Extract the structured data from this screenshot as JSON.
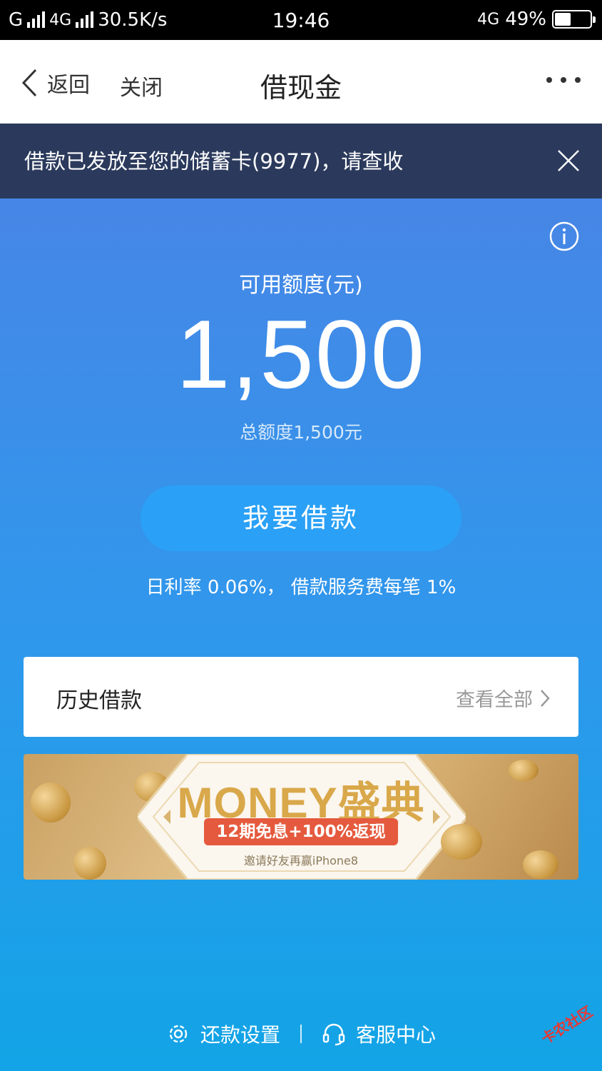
{
  "status_bar": {
    "carrier1": "G",
    "carrier2": "4G",
    "speed": "30.5K/s",
    "time": "19:46",
    "network": "4G",
    "battery": "49%"
  },
  "nav": {
    "back_label": "返回",
    "close_label": "关闭",
    "title": "借现金"
  },
  "notice": {
    "text": "借款已发放至您的储蓄卡(9977)，请查收"
  },
  "quota": {
    "label": "可用额度(元)",
    "value": "1,500",
    "total": "总额度1,500元"
  },
  "borrow": {
    "button_label": "我要借款",
    "rate_text": "日利率 0.06%， 借款服务费每笔 1%"
  },
  "history": {
    "title": "历史借款",
    "link_label": "查看全部"
  },
  "promo": {
    "title": "MONEY盛典",
    "pill": "12期免息+100%返现",
    "sub": "邀请好友再赢iPhone8"
  },
  "bottom": {
    "repay_settings": "还款设置",
    "customer_service": "客服中心"
  },
  "watermark": "卡农社区",
  "colors": {
    "notice_bg": "#2b3a5c",
    "button_bg": "#2aa0f6",
    "gradient_top": "#4786e6",
    "gradient_bottom": "#12a4e6",
    "promo_red": "#e55a3e"
  }
}
